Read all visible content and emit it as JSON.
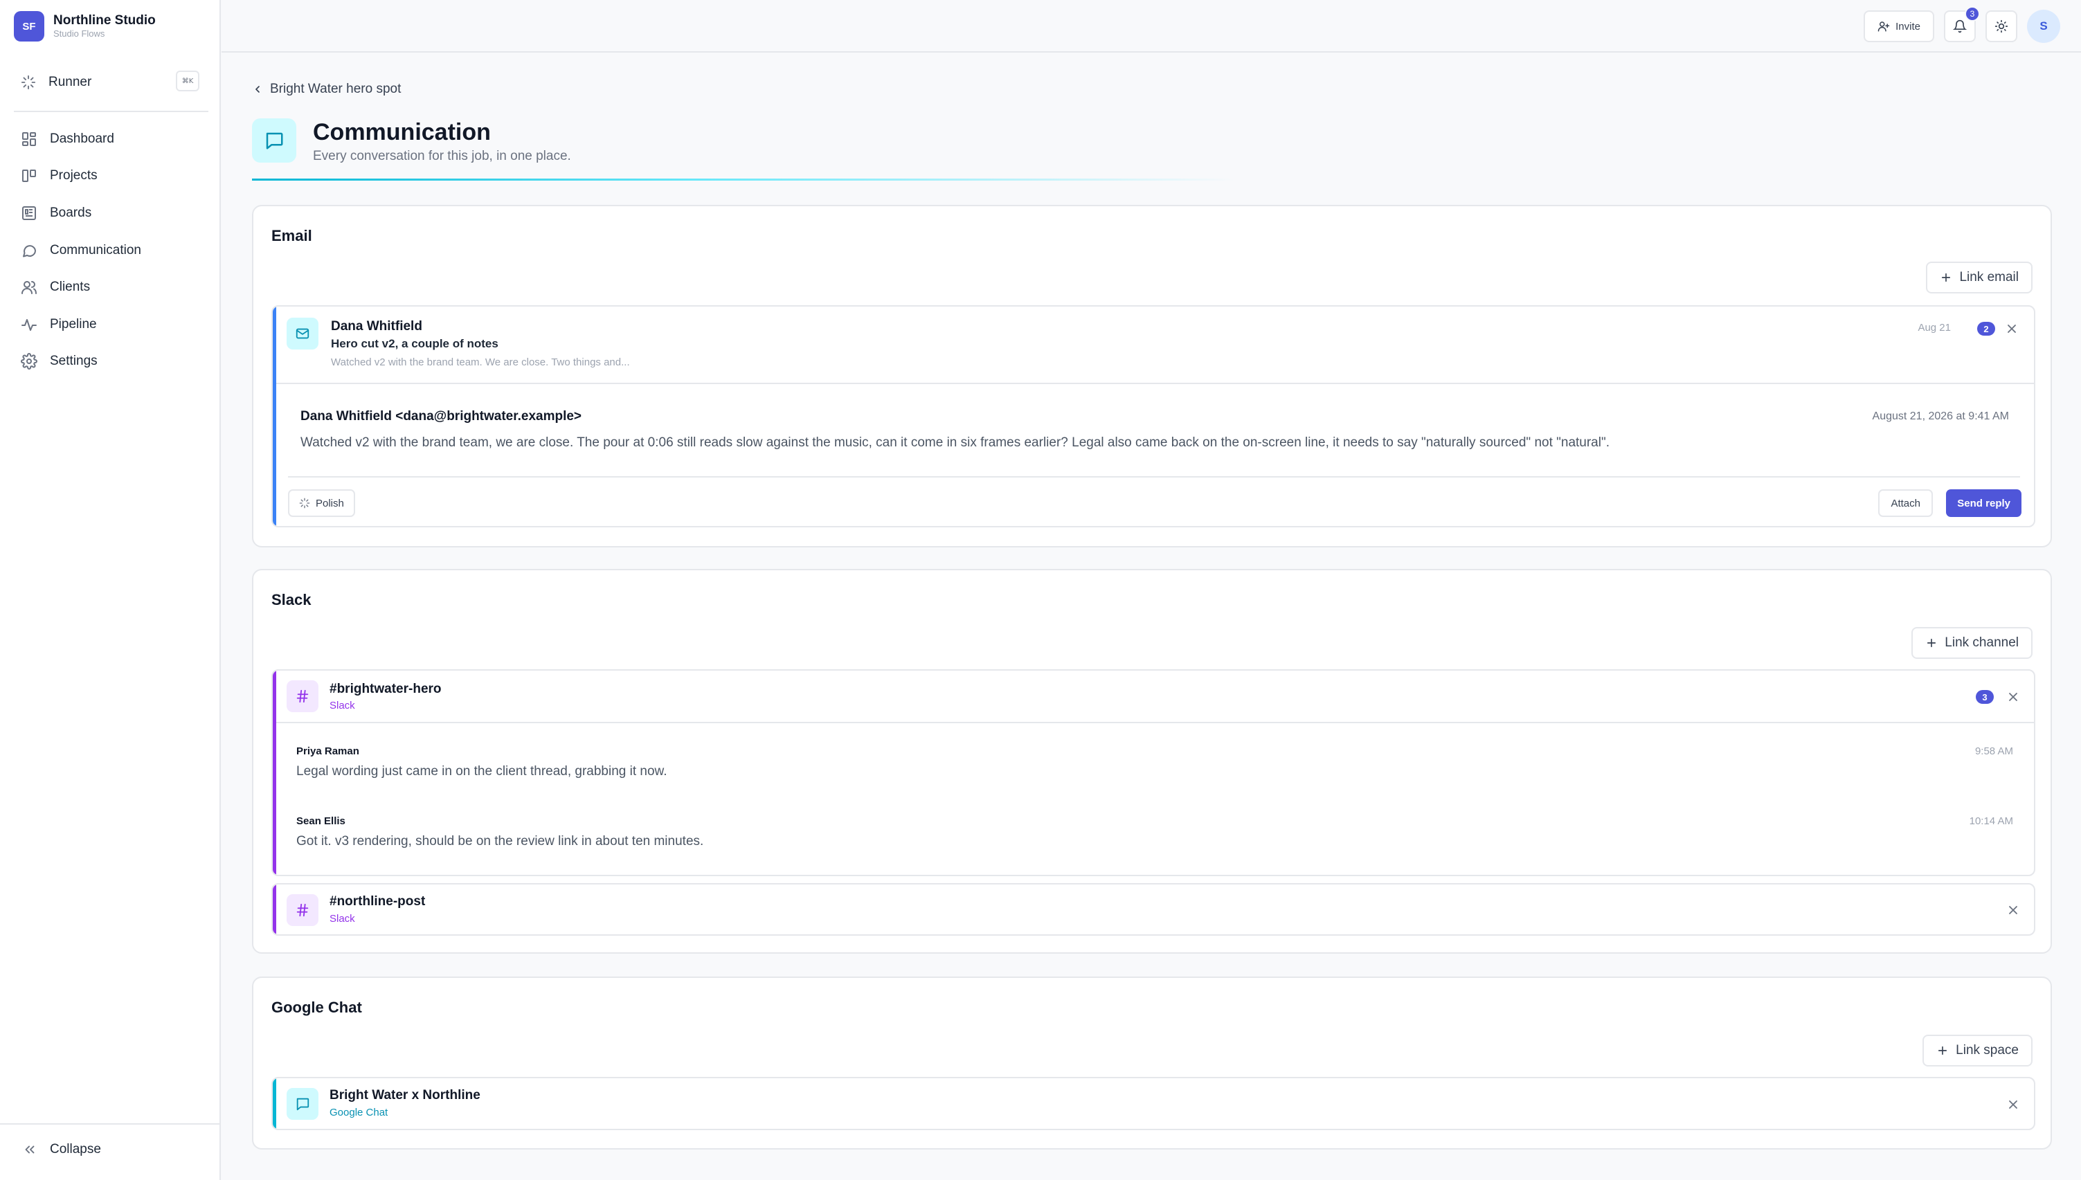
{
  "brand": {
    "initials": "SF",
    "name": "Northline Studio",
    "subtitle": "Studio Flows"
  },
  "runner": {
    "label": "Runner",
    "shortcut": "⌘K"
  },
  "nav": {
    "items": [
      {
        "label": "Dashboard",
        "icon": "dashboard-icon"
      },
      {
        "label": "Projects",
        "icon": "projects-icon"
      },
      {
        "label": "Boards",
        "icon": "boards-icon"
      },
      {
        "label": "Communication",
        "icon": "chat-icon"
      },
      {
        "label": "Clients",
        "icon": "users-icon"
      },
      {
        "label": "Pipeline",
        "icon": "pulse-icon"
      },
      {
        "label": "Settings",
        "icon": "gear-icon"
      }
    ]
  },
  "collapse_label": "Collapse",
  "topbar": {
    "invite_label": "Invite",
    "notification_count": "3",
    "avatar_initial": "S"
  },
  "breadcrumb": {
    "back_label": "Bright Water hero spot"
  },
  "page": {
    "title": "Communication",
    "subtitle": "Every conversation for this job, in one place."
  },
  "email_section": {
    "title": "Email",
    "link_label": "Link email",
    "thread": {
      "sender": "Dana Whitfield",
      "subject": "Hero cut v2, a couple of notes",
      "preview": "Watched v2 with the brand team. We are close. Two things and...",
      "date": "Aug 21",
      "count": "2",
      "from_full": "Dana Whitfield <dana@brightwater.example>",
      "datetime": "August 21, 2026 at 9:41 AM",
      "body": "Watched v2 with the brand team, we are close. The pour at 0:06 still reads slow against the music, can it come in six frames earlier? Legal also came back on the on-screen line, it needs to say \"naturally sourced\" not \"natural\".",
      "polish_label": "Polish",
      "attach_label": "Attach",
      "send_label": "Send reply"
    }
  },
  "slack_section": {
    "title": "Slack",
    "link_label": "Link channel",
    "channels": [
      {
        "name": "#brightwater-hero",
        "type": "Slack",
        "count": "3",
        "messages": [
          {
            "author": "Priya Raman",
            "time": "9:58 AM",
            "text": "Legal wording just came in on the client thread, grabbing it now."
          },
          {
            "author": "Sean Ellis",
            "time": "10:14 AM",
            "text": "Got it. v3 rendering, should be on the review link in about ten minutes."
          }
        ]
      },
      {
        "name": "#northline-post",
        "type": "Slack"
      }
    ]
  },
  "gchat_section": {
    "title": "Google Chat",
    "link_label": "Link space",
    "spaces": [
      {
        "name": "Bright Water x Northline",
        "type": "Google Chat"
      }
    ]
  },
  "colors": {
    "accent": "#4f56d9",
    "email_accent": "#3b82f6",
    "slack_accent": "#9333ea",
    "gchat_accent": "#06b6d4"
  }
}
